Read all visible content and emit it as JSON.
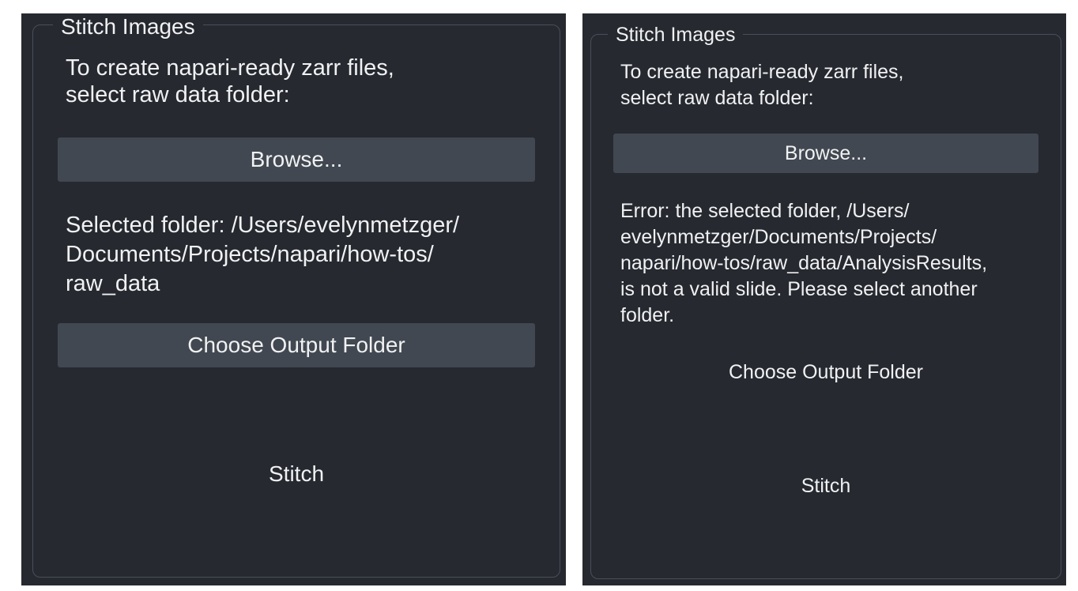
{
  "left_panel": {
    "group_title": "Stitch Images",
    "intro_text": "To create napari-ready zarr files,\nselect raw data folder:",
    "browse_label": "Browse...",
    "selected_folder_text": "Selected folder: /Users/evelynmetzger/\nDocuments/Projects/napari/how-tos/\nraw_data",
    "output_label": "Choose Output Folder",
    "stitch_label": "Stitch"
  },
  "right_panel": {
    "group_title": "Stitch Images",
    "intro_text": "To create napari-ready zarr files,\nselect raw data folder:",
    "browse_label": "Browse...",
    "error_text": "Error: the selected folder, /Users/\nevelynmetzger/Documents/Projects/\nnapari/how-tos/raw_data/AnalysisResults,\nis not a valid slide. Please select another\nfolder.",
    "output_label": "Choose Output Folder",
    "stitch_label": "Stitch"
  },
  "colors": {
    "panel_background": "#262930",
    "button_background": "#414851",
    "text": "#f0f1f2",
    "border": "#4a4e58"
  }
}
